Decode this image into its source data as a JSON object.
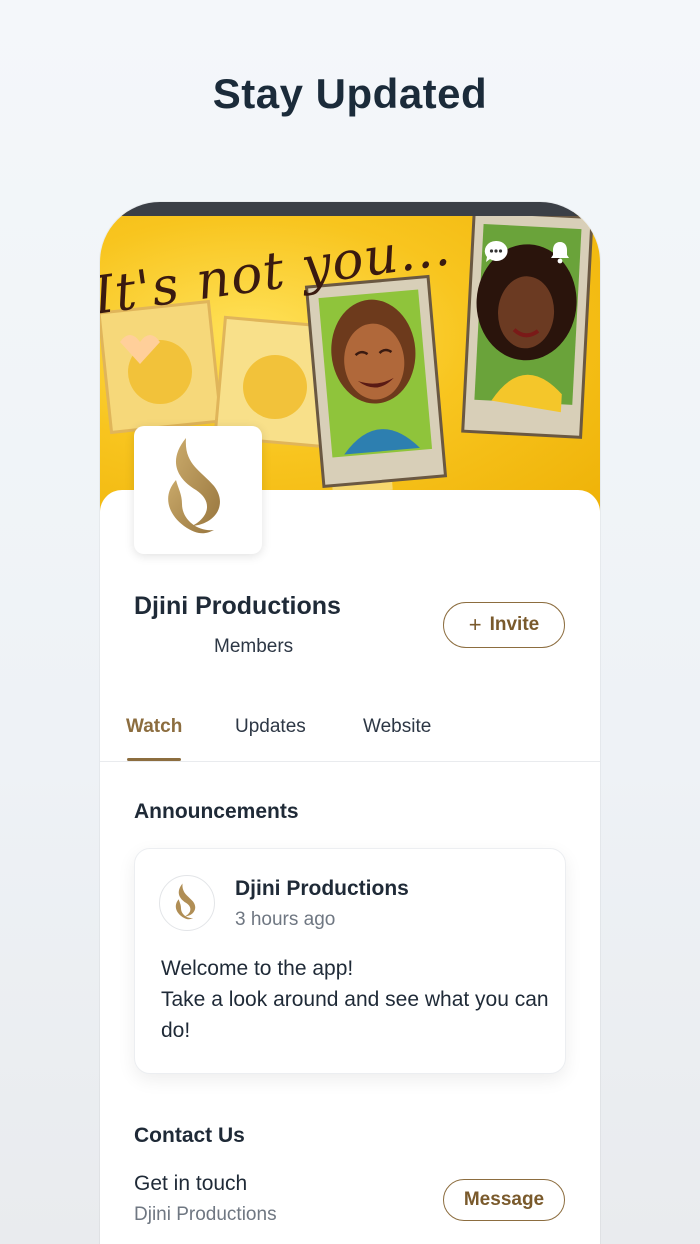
{
  "headline": "Stay Updated",
  "banner": {
    "script_text": "It's not you...",
    "icons": [
      "chat-bubble-icon",
      "bell-icon"
    ]
  },
  "profile": {
    "name": "Djini Productions",
    "members_label": "Members",
    "invite_label": "Invite",
    "logo": "djini-flame-logo"
  },
  "tabs": [
    {
      "label": "Watch",
      "active": true
    },
    {
      "label": "Updates",
      "active": false
    },
    {
      "label": "Website",
      "active": false
    }
  ],
  "announcements": {
    "title": "Announcements",
    "post": {
      "author": "Djini Productions",
      "time": "3 hours ago",
      "body_line1": "Welcome to the app!",
      "body_line2": "Take a look around and see what you can do!"
    }
  },
  "contact": {
    "title": "Contact Us",
    "subtitle": "Get in touch",
    "name": "Djini Productions",
    "message_label": "Message"
  },
  "colors": {
    "accent": "#8c6d3f",
    "text": "#1f2a37",
    "muted": "#6f7782",
    "banner_yellow": "#f8c51f"
  }
}
